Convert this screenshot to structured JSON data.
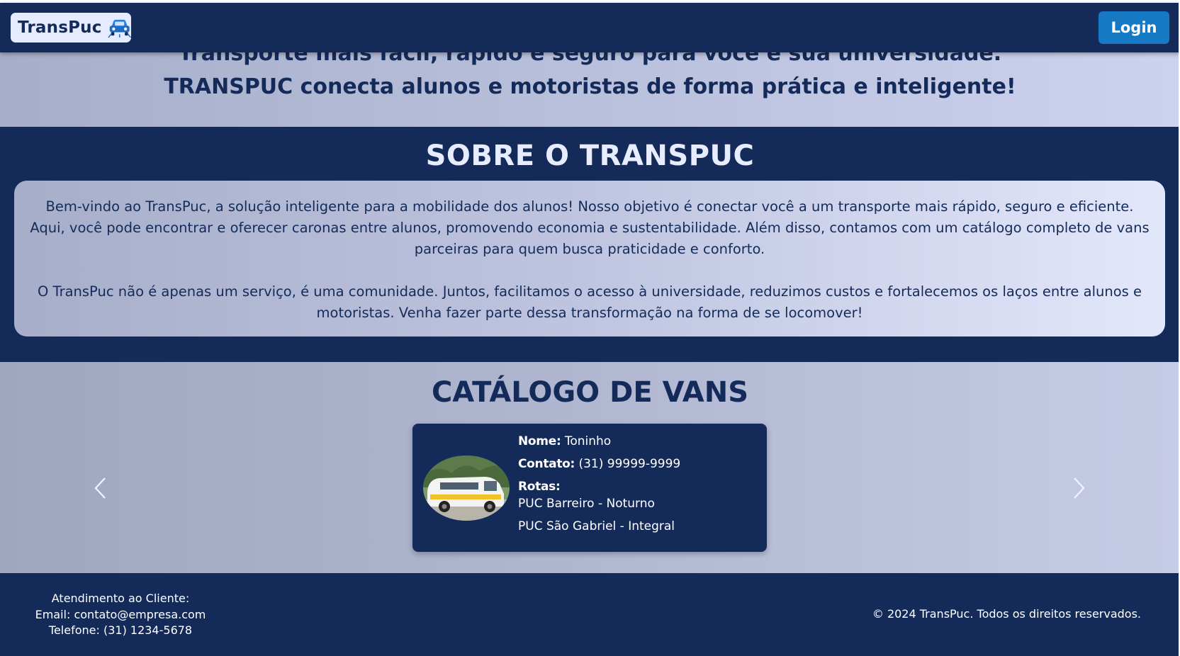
{
  "navbar": {
    "brand": "TransPuc",
    "login_label": "Login"
  },
  "hero": {
    "line1": "Transporte mais fácil, rápido e seguro para você e sua universidade.",
    "line2": "TRANSPUC conecta alunos e motoristas de forma prática e inteligente!"
  },
  "about": {
    "title": "SOBRE O TRANSPUC",
    "paragraph1": "Bem-vindo ao TransPuc, a solução inteligente para a mobilidade dos alunos! Nosso objetivo é conectar você a um transporte mais rápido, seguro e eficiente. Aqui, você pode encontrar e oferecer caronas entre alunos, promovendo economia e sustentabilidade. Além disso, contamos com um catálogo completo de vans parceiras para quem busca praticidade e conforto.",
    "paragraph2": "O TransPuc não é apenas um serviço, é uma comunidade. Juntos, facilitamos o acesso à universidade, reduzimos custos e fortalecemos os laços entre alunos e motoristas. Venha fazer parte dessa transformação na forma de se locomover!"
  },
  "catalog": {
    "title": "CATÁLOGO DE VANS",
    "van": {
      "name_label": "Nome:",
      "name": "Toninho",
      "contact_label": "Contato:",
      "contact": "(31) 99999-9999",
      "routes_label": "Rotas:",
      "routes": [
        "PUC Barreiro - Noturno",
        "PUC São Gabriel - Integral"
      ]
    }
  },
  "footer": {
    "contact_title": "Atendimento ao Cliente:",
    "email": "Email: contato@empresa.com",
    "phone": "Telefone: (31) 1234-5678",
    "copyright": "© 2024 TransPuc. Todos os direitos reservados."
  }
}
